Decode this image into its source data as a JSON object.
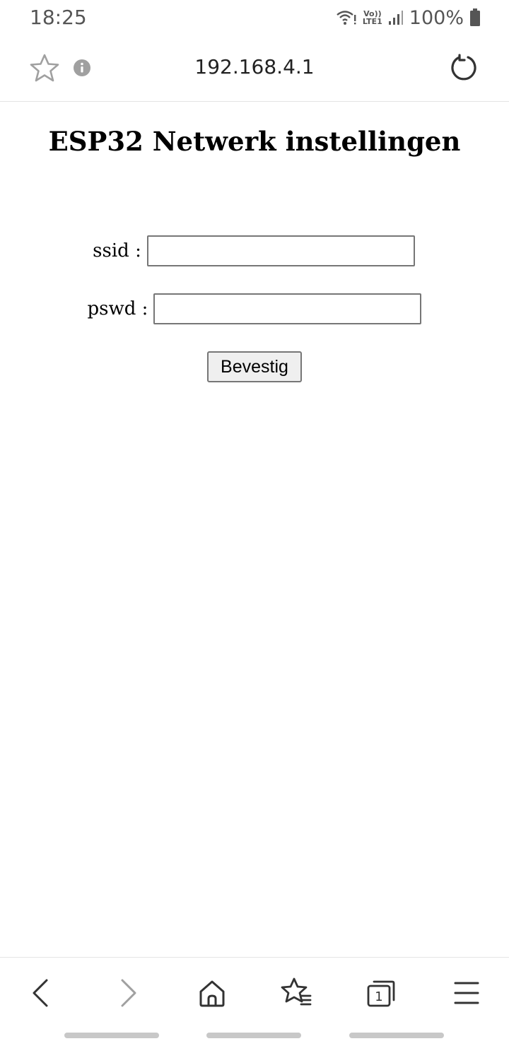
{
  "status_bar": {
    "time": "18:25",
    "network_volte": "Vo))",
    "network_lte": "LTE1",
    "battery_percent": "100%",
    "icons": [
      "wifi-icon",
      "signal-icon",
      "battery-icon"
    ]
  },
  "toolbar": {
    "url": "192.168.4.1",
    "icons": [
      "star-icon",
      "info-icon",
      "reload-icon"
    ]
  },
  "page": {
    "title": "ESP32 Netwerk instellingen",
    "form": {
      "ssid_label": "ssid :",
      "ssid_value": "",
      "pswd_label": "pswd :",
      "pswd_value": "",
      "submit_label": "Bevestig"
    }
  },
  "bottom_nav": {
    "tab_count": "1",
    "icons": [
      "back-icon",
      "forward-icon",
      "home-icon",
      "bookmarks-icon",
      "tabs-icon",
      "menu-icon"
    ]
  },
  "colors": {
    "icon_dark": "#333333",
    "icon_muted": "#a0a0a0",
    "status_text": "#555555"
  }
}
